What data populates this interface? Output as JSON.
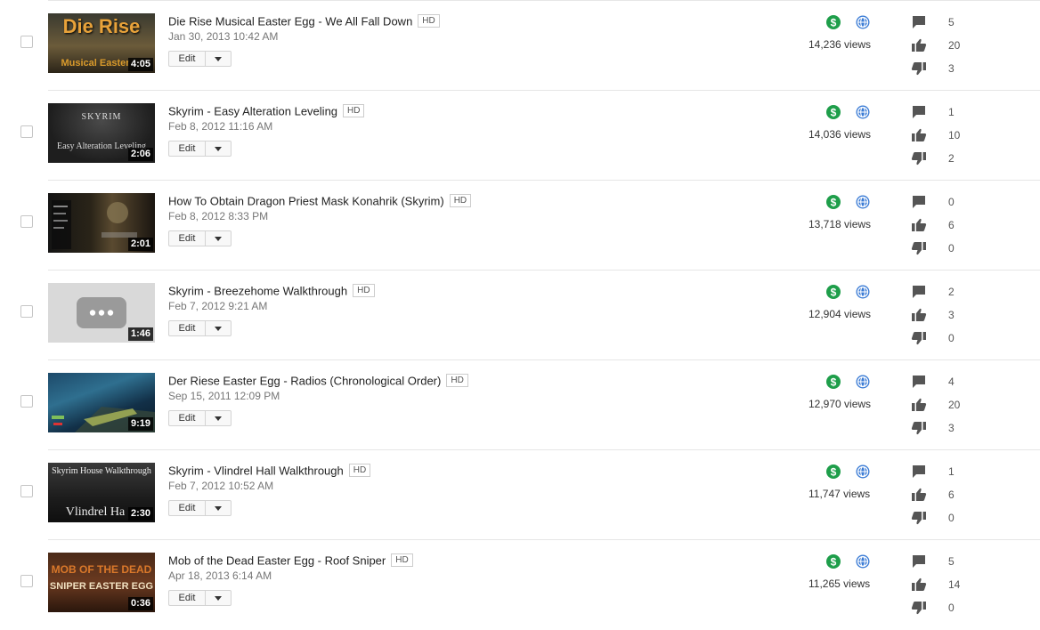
{
  "colors": {
    "money": "#1e9e4a",
    "globe": "#3a7bd5",
    "icon_gray": "#555555"
  },
  "icons": {
    "money": "dollar-circle-icon",
    "visibility": "globe-icon",
    "comments": "comment-icon",
    "likes": "thumbs-up-icon",
    "dislikes": "thumbs-down-icon",
    "dropdown": "chevron-down-icon"
  },
  "videos": [
    {
      "title": "Die Rise Musical Easter Egg - We All Fall Down",
      "hd": "HD",
      "date": "Jan 30, 2013 10:42 AM",
      "duration": "4:05",
      "edit": "Edit",
      "views": "14,236 views",
      "comments": "5",
      "likes": "20",
      "dislikes": "3",
      "thumb_text_1": "Die Rise",
      "thumb_text_2": "Musical Easter"
    },
    {
      "title": "Skyrim - Easy Alteration Leveling",
      "hd": "HD",
      "date": "Feb 8, 2012 11:16 AM",
      "duration": "2:06",
      "edit": "Edit",
      "views": "14,036 views",
      "comments": "1",
      "likes": "10",
      "dislikes": "2",
      "thumb_text_1": "SKYRIM",
      "thumb_text_2": "Easy Alteration Leveling"
    },
    {
      "title": "How To Obtain Dragon Priest Mask Konahrik (Skyrim)",
      "hd": "HD",
      "date": "Feb 8, 2012 8:33 PM",
      "duration": "2:01",
      "edit": "Edit",
      "views": "13,718 views",
      "comments": "0",
      "likes": "6",
      "dislikes": "0"
    },
    {
      "title": "Skyrim - Breezehome Walkthrough",
      "hd": "HD",
      "date": "Feb 7, 2012 9:21 AM",
      "duration": "1:46",
      "edit": "Edit",
      "views": "12,904 views",
      "comments": "2",
      "likes": "3",
      "dislikes": "0"
    },
    {
      "title": "Der Riese Easter Egg - Radios (Chronological Order)",
      "hd": "HD",
      "date": "Sep 15, 2011 12:09 PM",
      "duration": "9:19",
      "edit": "Edit",
      "views": "12,970 views",
      "comments": "4",
      "likes": "20",
      "dislikes": "3"
    },
    {
      "title": "Skyrim - Vlindrel Hall Walkthrough",
      "hd": "HD",
      "date": "Feb 7, 2012 10:52 AM",
      "duration": "2:30",
      "edit": "Edit",
      "views": "11,747 views",
      "comments": "1",
      "likes": "6",
      "dislikes": "0",
      "thumb_text_1": "Skyrim House Walkthrough",
      "thumb_text_2": "Vlindrel Ha"
    },
    {
      "title": "Mob of the Dead Easter Egg - Roof Sniper",
      "hd": "HD",
      "date": "Apr 18, 2013 6:14 AM",
      "duration": "0:36",
      "edit": "Edit",
      "views": "11,265 views",
      "comments": "5",
      "likes": "14",
      "dislikes": "0",
      "thumb_text_1": "MOB OF THE DEAD",
      "thumb_text_2": "SNIPER EASTER EGG"
    }
  ]
}
